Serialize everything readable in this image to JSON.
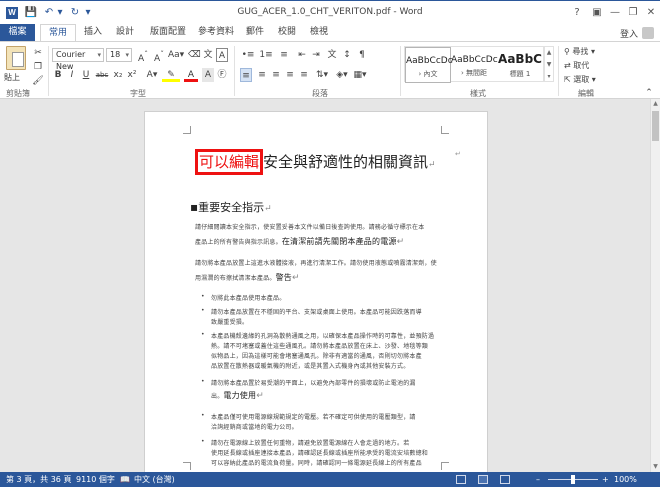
{
  "app": {
    "window_title": "GUG_ACER_1.0_CHT_VERITON.pdf - Word",
    "help": "?",
    "sign_in": "登入"
  },
  "tabs": [
    "檔案",
    "常用",
    "插入",
    "設計",
    "版面配置",
    "參考資料",
    "郵件",
    "校閱",
    "檢視"
  ],
  "ribbon": {
    "clipboard": {
      "label": "剪貼簿",
      "paste": "貼上"
    },
    "font": {
      "label": "字型",
      "font_name": "Courier New",
      "font_size": "18",
      "buttons": [
        "B",
        "I",
        "U",
        "abc",
        "x₂",
        "x²"
      ]
    },
    "paragraph": {
      "label": "段落"
    },
    "styles": {
      "label": "樣式",
      "items": [
        {
          "sample": "AaBbCcDc",
          "name": "› 內文"
        },
        {
          "sample": "AaBbCcDc",
          "name": "› 無間距"
        },
        {
          "sample": "AaBbC",
          "name": "標題 1"
        }
      ]
    },
    "editing": {
      "label": "編輯",
      "find": "尋找",
      "replace": "取代",
      "select": "選取"
    }
  },
  "document": {
    "heading_boxed": "可以編輯",
    "heading_rest": "安全與舒適性的相關資訊",
    "section_title": "重要安全指示",
    "para1_l1": "請仔細閱讀本安全指示，使安置妥善本文件以備日後查詢使用。請務必循守標示在本",
    "para1_l2": "產品上的所有警告與指示訊息。",
    "para1_l2_big": "在清潔前請先關閉本產品的電源",
    "para2_l1": "請勿將本產品放置上這進水液體接液，再進行清潔工作。請勿使用液態或噴霧清潔劑，使",
    "para2_l2": "用濕潤的布擦拭清潔本產品。",
    "para2_l2_big": "警告",
    "bullets": [
      [
        "勿將此本產品使用本產品。"
      ],
      [
        "請勿本產品放置在不穩固的平台、支架或桌面上使用。本產品可能因跌落而導",
        "致嚴重受損。"
      ],
      [
        "本產品機殼邊緣的孔洞為散熱通風之用，以確保本產品操作時的可靠性，並預防過",
        "熱。請不可堵塞或蓋住這些通風孔。請勿將本產品放置在床上、沙發、地毯等類",
        "似物品上，因為這樣可能會堵塞通風孔。除非有適當的通風，否則切勿將本產",
        "品放置在散熱器或暖氣機的附近，或是其置入式機身內或其他安裝方式。"
      ],
      [
        "請勿將本產品置於易受潮的平面上，以避免內部零件的損壞或防止電池的漏",
        "出。"
      ],
      [
        "本產品僅可使用電源線規範規定的電壓。若不確定可供使用的電壓類型，請",
        "洽詢經銷商或當地的電力公司。"
      ],
      [
        "請勿在電源線上放置任何重物，請避免放置電源線在人會走過的地方。若",
        "使用延長線或插座連接本產品，請確認延長線或插座所能承受的電流安培數總和",
        "可以容納此產品的電流負荷量。同時，請確認同一條電源延長線上的所有產品"
      ]
    ],
    "bullet_big_tails": {
      "b3": "電力使用"
    }
  },
  "status": {
    "page": "第 3 頁，共 36 頁",
    "words": "9110 個字",
    "language": "中文 (台灣)",
    "zoom": "100%"
  },
  "colors": {
    "accent": "#2b579a",
    "edit_box": "#e11111"
  }
}
